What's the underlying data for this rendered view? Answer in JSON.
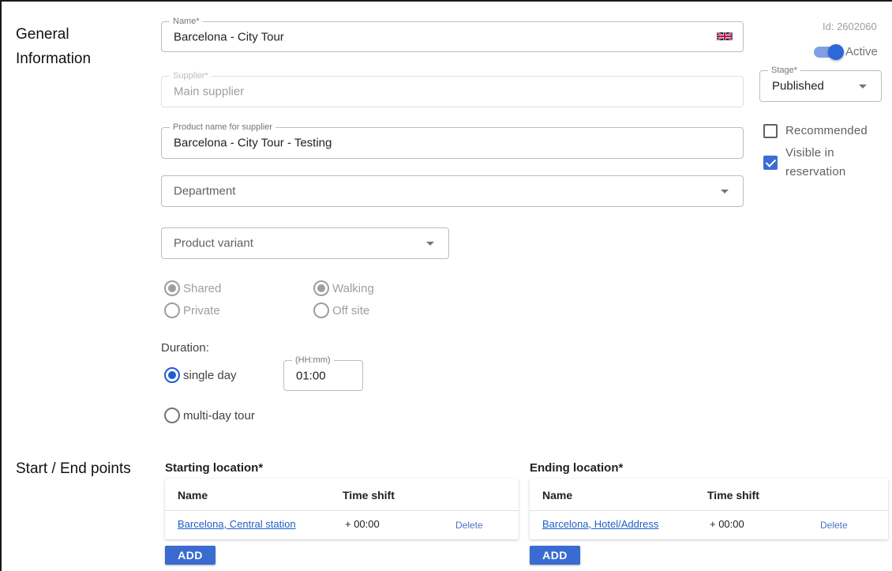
{
  "general": {
    "section_title_line1": "General",
    "section_title_line2": "Information",
    "id_text": "Id: 2602060",
    "active_label": "Active",
    "name": {
      "label": "Name*",
      "value": "Barcelona - City Tour",
      "flag_icon": "uk-flag-icon"
    },
    "supplier": {
      "label": "Supplier*",
      "value": "Main supplier"
    },
    "product_name_supplier": {
      "label": "Product name for supplier",
      "value": "Barcelona - City Tour - Testing"
    },
    "department": {
      "placeholder": "Department"
    },
    "product_variant": {
      "placeholder": "Product variant"
    },
    "stage": {
      "label": "Stage*",
      "value": "Published"
    },
    "recommended": {
      "label": "Recommended",
      "checked": false
    },
    "visible_in_reservation": {
      "label_line1": "Visible in",
      "label_line2": "reservation",
      "checked": true
    },
    "type_options": [
      {
        "label": "Shared",
        "selected": true
      },
      {
        "label": "Private",
        "selected": false
      }
    ],
    "mode_options": [
      {
        "label": "Walking",
        "selected": true
      },
      {
        "label": "Off site",
        "selected": false
      }
    ],
    "duration": {
      "label": "Duration:",
      "single_day": "single day",
      "multi_day": "multi-day tour",
      "time_label": "(HH:mm)",
      "time_value": "01:00"
    }
  },
  "endpoints": {
    "section_title": "Start / End points",
    "starting": {
      "title": "Starting location*",
      "columns": [
        "Name",
        "Time shift"
      ],
      "rows": [
        {
          "name": "Barcelona, Central station",
          "shift": "+ 00:00",
          "action": "Delete"
        }
      ],
      "add_label": "ADD"
    },
    "ending": {
      "title": "Ending location*",
      "columns": [
        "Name",
        "Time shift"
      ],
      "rows": [
        {
          "name": "Barcelona, Hotel/Address",
          "shift": "+ 00:00",
          "action": "Delete"
        }
      ],
      "add_label": "ADD"
    }
  },
  "colors": {
    "accent": "#2e68d8",
    "link": "#1f5fc8"
  }
}
